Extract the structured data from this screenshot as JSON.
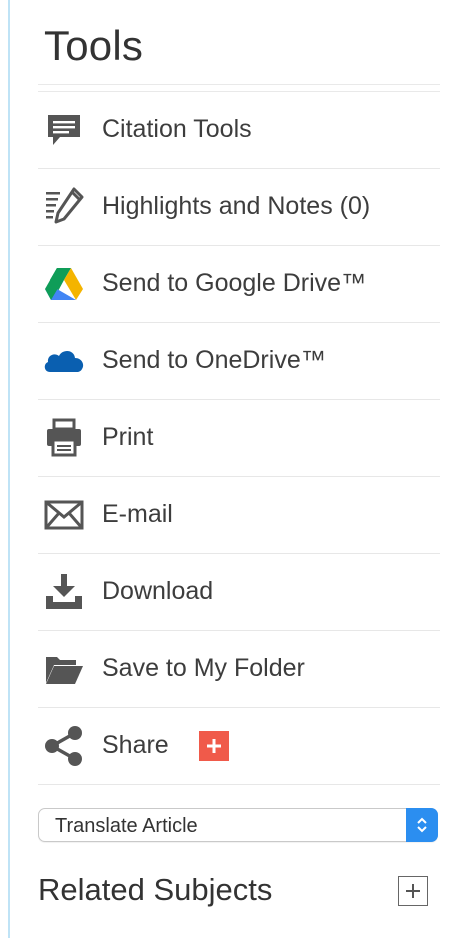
{
  "panel": {
    "title": "Tools"
  },
  "tools": [
    {
      "id": "citation",
      "label": "Citation Tools",
      "icon": "speech-bubble-icon"
    },
    {
      "id": "highlights",
      "label": "Highlights and Notes (0)",
      "icon": "pencil-notes-icon"
    },
    {
      "id": "google-drive",
      "label": "Send to Google Drive™",
      "icon": "google-drive-icon"
    },
    {
      "id": "onedrive",
      "label": "Send to OneDrive™",
      "icon": "onedrive-cloud-icon"
    },
    {
      "id": "print",
      "label": "Print",
      "icon": "printer-icon"
    },
    {
      "id": "email",
      "label": "E-mail",
      "icon": "envelope-icon"
    },
    {
      "id": "download",
      "label": "Download",
      "icon": "download-icon"
    },
    {
      "id": "folder",
      "label": "Save to My Folder",
      "icon": "folder-icon"
    },
    {
      "id": "share",
      "label": "Share",
      "icon": "share-icon",
      "badge_icon": "plus-icon"
    }
  ],
  "translate": {
    "selected": "Translate Article",
    "icon": "updown-chevron-icon"
  },
  "related": {
    "label": "Related Subjects",
    "toggle_icon": "plus-box-icon"
  },
  "colors": {
    "accent_blue": "#2b8ef0",
    "share_red": "#f05a4a",
    "onedrive_blue": "#0a5fb0",
    "icon_gray": "#555555",
    "left_rule": "#bfe3f6"
  }
}
